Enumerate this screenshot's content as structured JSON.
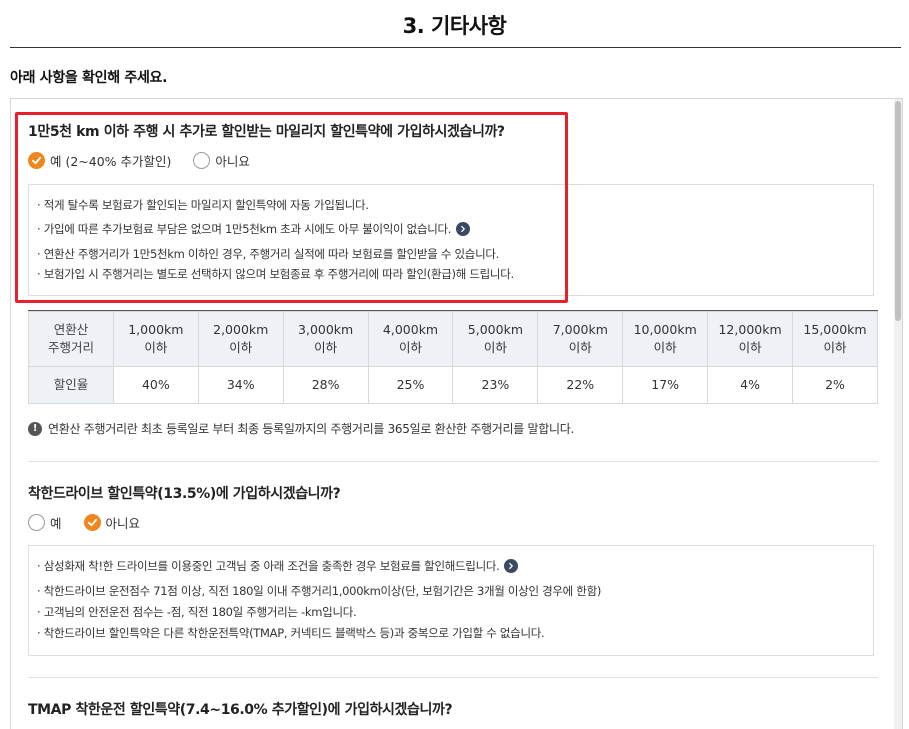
{
  "page": {
    "title": "3. 기타사항",
    "intro": "아래 사항을 확인해 주세요."
  },
  "mileage": {
    "question": "1만5천 km 이하 주행 시 추가로 할인받는 마일리지 할인특약에 가입하시겠습니까?",
    "options": [
      {
        "label": "예 (2~40% 추가할인)",
        "selected": true
      },
      {
        "label": "아니요",
        "selected": false
      }
    ],
    "info": [
      "· 적게 탈수록 보험료가 할인되는 마일리지 할인특약에 자동 가입됩니다.",
      "· 가입에 따른 추가보험료 부담은 없으며 1만5천km 초과 시에도 아무 불이익이 없습니다.",
      "· 연환산 주행거리가 1만5천km 이하인 경우, 주행거리 실적에 따라 보험료를 할인받을 수 있습니다.",
      "· 보험가입 시 주행거리는 별도로 선택하지 않으며 보험종료 후 주행거리에 따라 할인(환급)해 드립니다."
    ],
    "table": {
      "row_head_1": "연환산\n주행거리",
      "row_head_2": "할인율",
      "distances": [
        "1,000km\n이하",
        "2,000km\n이하",
        "3,000km\n이하",
        "4,000km\n이하",
        "5,000km\n이하",
        "7,000km\n이하",
        "10,000km\n이하",
        "12,000km\n이하",
        "15,000km\n이하"
      ],
      "rates": [
        "40%",
        "34%",
        "28%",
        "25%",
        "23%",
        "22%",
        "17%",
        "4%",
        "2%"
      ]
    },
    "note": "연환산 주행거리란 최초 등록일로 부터 최종 등록일까지의 주행거리를 365일로 환산한 주행거리를 말합니다."
  },
  "safe_drive": {
    "question": "착한드라이브 할인특약(13.5%)에 가입하시겠습니까?",
    "options": [
      {
        "label": "예",
        "selected": false
      },
      {
        "label": "아니요",
        "selected": true
      }
    ],
    "info": [
      "· 삼성화재 착!한 드라이브를 이용중인 고객님 중 아래 조건을 충족한 경우 보험료를 할인해드립니다.",
      "· 착한드라이브 운전점수 71점 이상, 직전 180일 이내 주행거리1,000km이상(단, 보험기간은 3개월 이상인 경우에 한함)",
      "· 고객님의 안전운전 점수는 -점, 직전 180일 주행거리는 -km입니다.",
      "· 착한드라이브 할인특약은 다른 착한운전특약(TMAP, 커넥티드 블랙박스 등)과 중복으로 가입할 수 없습니다."
    ]
  },
  "tmap": {
    "question": "TMAP 착한운전 할인특약(7.4~16.0% 추가할인)에 가입하시겠습니까?"
  },
  "colors": {
    "accent": "#f0861e",
    "highlight": "#e8202c",
    "arrow": "#3a4a63"
  }
}
